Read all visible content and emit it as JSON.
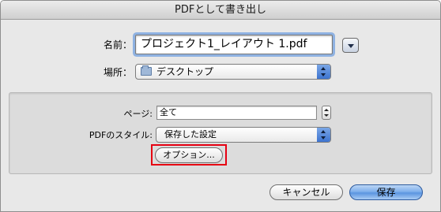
{
  "window": {
    "title": "PDFとして書き出し"
  },
  "file": {
    "name_label": "名前：",
    "name_value": "プロジェクト1_レイアウト 1.pdf",
    "location_label": "場所：",
    "location_value": "デスクトップ"
  },
  "options": {
    "pages_label": "ページ:",
    "pages_value": "全て",
    "style_label": "PDFのスタイル:",
    "style_value": "保存した設定",
    "options_button": "オプション..."
  },
  "footer": {
    "cancel_button": "キャンセル",
    "save_button": "保存"
  }
}
